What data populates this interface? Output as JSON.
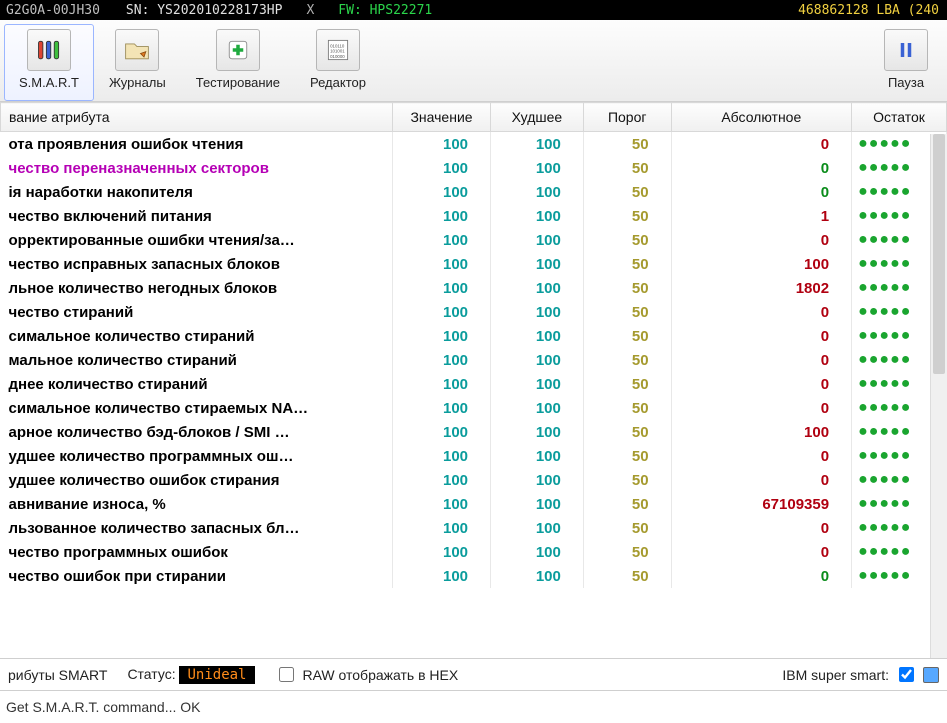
{
  "titlebar": {
    "model_fragment": "G2G0A-00JH30",
    "sn": "SN: YS202010228173HP",
    "fw": "FW: HPS22271",
    "lba": "468862128 LBA (240"
  },
  "toolbar": {
    "smart": "S.M.A.R.T",
    "journals": "Журналы",
    "testing": "Тестирование",
    "editor": "Редактор",
    "pause": "Пауза"
  },
  "columns": {
    "name": "вание атрибута",
    "value": "Значение",
    "worst": "Худшее",
    "thresh": "Порог",
    "absolute": "Абсолютное",
    "remaining": "Остаток"
  },
  "rows": [
    {
      "name": "ота проявления ошибок чтения",
      "val": 100,
      "worst": 100,
      "thr": 50,
      "abs": 0,
      "abs_color": "red",
      "purple": false
    },
    {
      "name": "чество переназначенных секторов",
      "val": 100,
      "worst": 100,
      "thr": 50,
      "abs": 0,
      "abs_color": "green",
      "purple": true
    },
    {
      "name": "ія наработки накопителя",
      "val": 100,
      "worst": 100,
      "thr": 50,
      "abs": 0,
      "abs_color": "green",
      "purple": false
    },
    {
      "name": "чество включений питания",
      "val": 100,
      "worst": 100,
      "thr": 50,
      "abs": 1,
      "abs_color": "red",
      "purple": false
    },
    {
      "name": "орректированные ошибки чтения/за…",
      "val": 100,
      "worst": 100,
      "thr": 50,
      "abs": 0,
      "abs_color": "red",
      "purple": false
    },
    {
      "name": "чество исправных запасных блоков",
      "val": 100,
      "worst": 100,
      "thr": 50,
      "abs": 100,
      "abs_color": "red",
      "purple": false
    },
    {
      "name": "льное количество негодных блоков",
      "val": 100,
      "worst": 100,
      "thr": 50,
      "abs": 1802,
      "abs_color": "red",
      "purple": false
    },
    {
      "name": "чество стираний",
      "val": 100,
      "worst": 100,
      "thr": 50,
      "abs": 0,
      "abs_color": "red",
      "purple": false
    },
    {
      "name": "симальное количество стираний",
      "val": 100,
      "worst": 100,
      "thr": 50,
      "abs": 0,
      "abs_color": "red",
      "purple": false
    },
    {
      "name": "мальное количество стираний",
      "val": 100,
      "worst": 100,
      "thr": 50,
      "abs": 0,
      "abs_color": "red",
      "purple": false
    },
    {
      "name": "днее количество стираний",
      "val": 100,
      "worst": 100,
      "thr": 50,
      "abs": 0,
      "abs_color": "red",
      "purple": false
    },
    {
      "name": "симальное количество стираемых NA…",
      "val": 100,
      "worst": 100,
      "thr": 50,
      "abs": 0,
      "abs_color": "red",
      "purple": false
    },
    {
      "name": "арное количество бэд-блоков / SMI …",
      "val": 100,
      "worst": 100,
      "thr": 50,
      "abs": 100,
      "abs_color": "red",
      "purple": false
    },
    {
      "name": "удшее количество программных ош…",
      "val": 100,
      "worst": 100,
      "thr": 50,
      "abs": 0,
      "abs_color": "red",
      "purple": false
    },
    {
      "name": "удшее количество ошибок стирания",
      "val": 100,
      "worst": 100,
      "thr": 50,
      "abs": 0,
      "abs_color": "red",
      "purple": false
    },
    {
      "name": "авнивание износа, %",
      "val": 100,
      "worst": 100,
      "thr": 50,
      "abs": 67109359,
      "abs_color": "red",
      "purple": false
    },
    {
      "name": "льзованное количество запасных бл…",
      "val": 100,
      "worst": 100,
      "thr": 50,
      "abs": 0,
      "abs_color": "red",
      "purple": false
    },
    {
      "name": "чество программных ошибок",
      "val": 100,
      "worst": 100,
      "thr": 50,
      "abs": 0,
      "abs_color": "red",
      "purple": false
    },
    {
      "name": "чество ошибок при стирании",
      "val": 100,
      "worst": 100,
      "thr": 50,
      "abs": 0,
      "abs_color": "green",
      "purple": false
    }
  ],
  "bottom": {
    "attrs_label": "рибуты SMART",
    "status_label": "Статус:",
    "status_value": "Unideal",
    "raw_hex_label": "RAW отображать в HEX",
    "ibm_label": "IBM super smart:"
  },
  "log": {
    "line": "Get S.M.A.R.T. command... OK"
  },
  "colors": {
    "teal": "#0a9c9c",
    "olive": "#a59a2e",
    "red": "#b00010",
    "green": "#0a8c1a",
    "purple": "#b500b5"
  }
}
